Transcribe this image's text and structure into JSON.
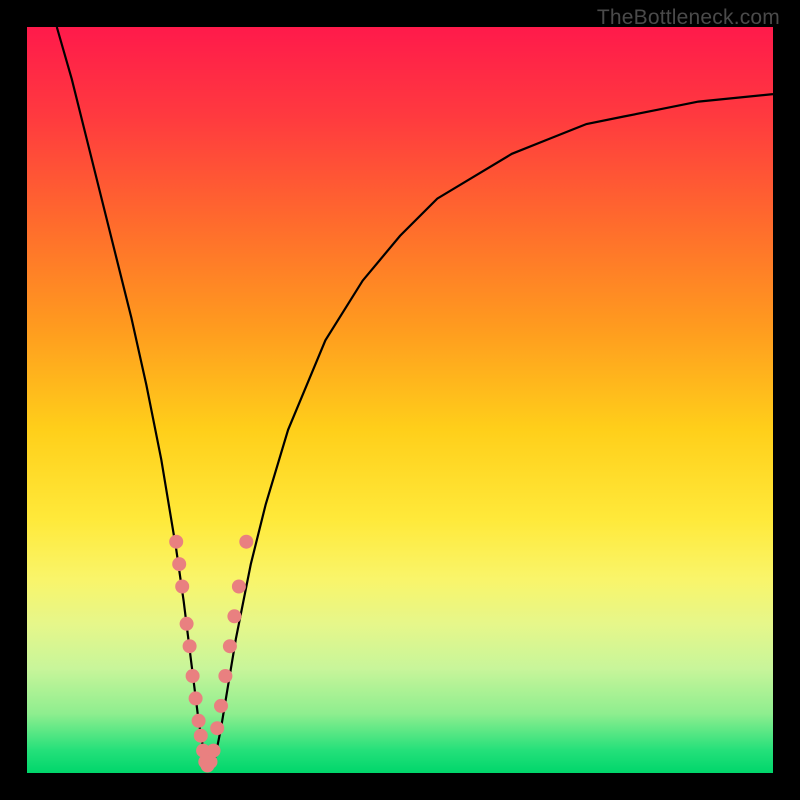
{
  "watermark": "TheBottleneck.com",
  "colors": {
    "frame": "#000000",
    "gradient_top": "#ff1a4b",
    "gradient_bottom": "#00d66b",
    "curve": "#000000",
    "points": "#e98080"
  },
  "chart_data": {
    "type": "line",
    "title": "",
    "xlabel": "",
    "ylabel": "",
    "xlim": [
      0,
      100
    ],
    "ylim": [
      0,
      100
    ],
    "note": "Axes unlabeled; values estimated from pixel positions on a 0–100 normalized scale. y ≈ bottleneck %; curve dips to ~0 near x≈24.",
    "series": [
      {
        "name": "bottleneck-curve",
        "x": [
          4,
          6,
          8,
          10,
          12,
          14,
          16,
          18,
          20,
          21,
          22,
          23,
          24,
          25,
          26,
          27,
          28,
          30,
          32,
          35,
          40,
          45,
          50,
          55,
          60,
          65,
          70,
          75,
          80,
          85,
          90,
          95,
          100
        ],
        "y": [
          100,
          93,
          85,
          77,
          69,
          61,
          52,
          42,
          30,
          23,
          15,
          7,
          1,
          1,
          6,
          12,
          18,
          28,
          36,
          46,
          58,
          66,
          72,
          77,
          80,
          83,
          85,
          87,
          88,
          89,
          90,
          90.5,
          91
        ]
      }
    ],
    "points_overlay": [
      {
        "x": 20.0,
        "y": 31
      },
      {
        "x": 20.4,
        "y": 28
      },
      {
        "x": 20.8,
        "y": 25
      },
      {
        "x": 21.4,
        "y": 20
      },
      {
        "x": 21.8,
        "y": 17
      },
      {
        "x": 22.2,
        "y": 13
      },
      {
        "x": 22.6,
        "y": 10
      },
      {
        "x": 23.0,
        "y": 7
      },
      {
        "x": 23.3,
        "y": 5
      },
      {
        "x": 23.6,
        "y": 3
      },
      {
        "x": 23.9,
        "y": 1.5
      },
      {
        "x": 24.2,
        "y": 1
      },
      {
        "x": 24.6,
        "y": 1.5
      },
      {
        "x": 25.0,
        "y": 3
      },
      {
        "x": 25.5,
        "y": 6
      },
      {
        "x": 26.0,
        "y": 9
      },
      {
        "x": 26.6,
        "y": 13
      },
      {
        "x": 27.2,
        "y": 17
      },
      {
        "x": 27.8,
        "y": 21
      },
      {
        "x": 28.4,
        "y": 25
      },
      {
        "x": 29.4,
        "y": 31
      }
    ]
  }
}
